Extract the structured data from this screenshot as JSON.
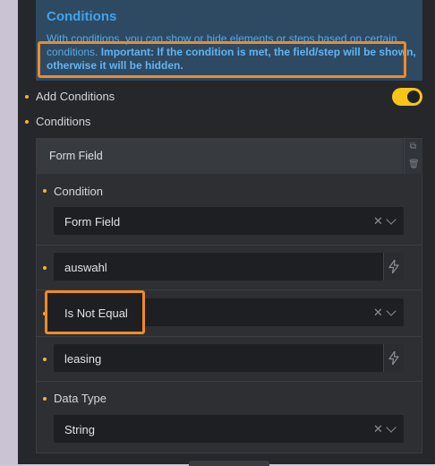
{
  "info": {
    "title": "Conditions",
    "text_lead": "With conditions, you can show or hide elements or steps based on certain conditions.",
    "text_important": "Important: If the condition is met, the field/step will be shown, otherwise it will be hidden."
  },
  "settings": {
    "add_conditions_label": "Add Conditions",
    "add_conditions_enabled": true,
    "conditions_label": "Conditions"
  },
  "condition_card": {
    "header_label": "Form Field",
    "condition_label": "Condition",
    "condition_value": "Form Field",
    "field_value": "auswahl",
    "operator_value": "Is Not Equal",
    "compare_value": "leasing",
    "data_type_label": "Data Type",
    "data_type_value": "String"
  },
  "colors": {
    "accent": "#f5c518",
    "highlight": "#f28a22",
    "info_bg": "#2e4a63",
    "info_text": "#57a9e6"
  }
}
